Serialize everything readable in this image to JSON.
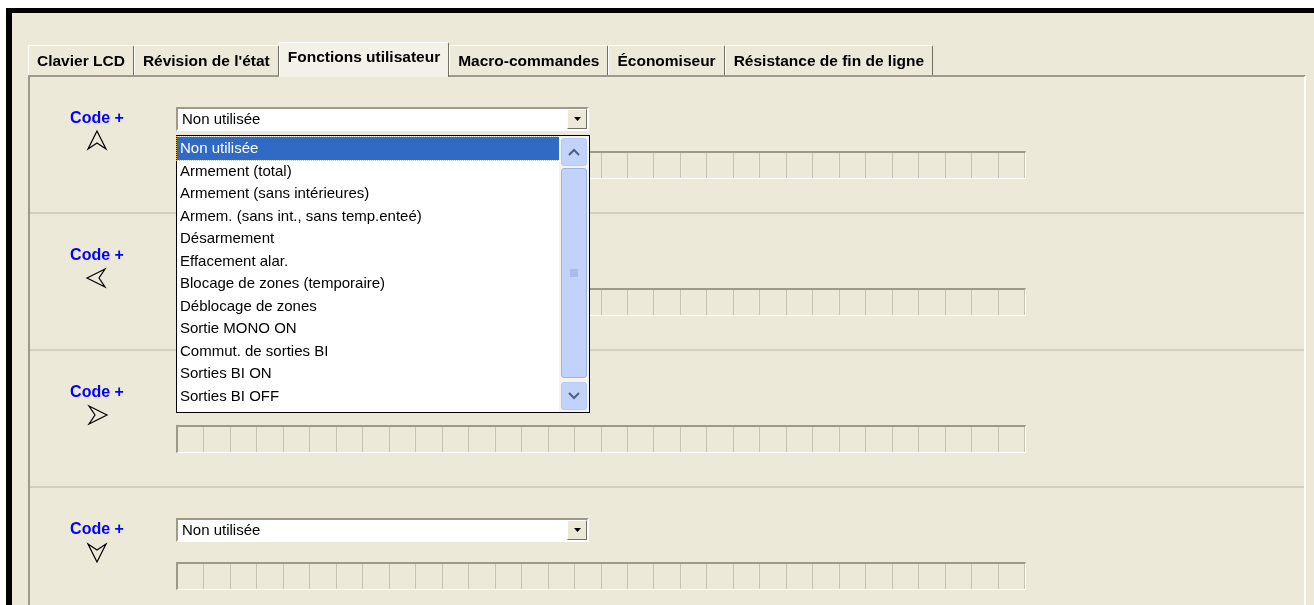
{
  "tabs": [
    {
      "label": "Clavier LCD",
      "selected": false
    },
    {
      "label": "Révision de l'état",
      "selected": false
    },
    {
      "label": "Fonctions utilisateur",
      "selected": true
    },
    {
      "label": "Macro-commandes",
      "selected": false
    },
    {
      "label": "Économiseur",
      "selected": false
    },
    {
      "label": "Résistance de fin de ligne",
      "selected": false
    }
  ],
  "sections": [
    {
      "label": "Code +",
      "kind": "up",
      "combo": {
        "value": "Non utilisée",
        "options": [
          {
            "label": "Non utilisée",
            "selected": true
          },
          {
            "label": "Armement (total)",
            "selected": false
          },
          {
            "label": "Armement (sans intérieures)",
            "selected": false
          },
          {
            "label": "Armem. (sans int., sans temp.enteé)",
            "selected": false
          },
          {
            "label": "Désarmement",
            "selected": false
          },
          {
            "label": "Effacement alar.",
            "selected": false
          },
          {
            "label": "Blocage de zones (temporaire)",
            "selected": false
          },
          {
            "label": "Déblocage de zones",
            "selected": false
          },
          {
            "label": "Sortie MONO ON",
            "selected": false
          },
          {
            "label": "Commut. de sorties BI",
            "selected": false
          },
          {
            "label": "Sorties BI ON",
            "selected": false
          },
          {
            "label": "Sorties BI OFF",
            "selected": false
          }
        ]
      }
    },
    {
      "label": "Code +",
      "kind": "left"
    },
    {
      "label": "Code +",
      "kind": "right"
    },
    {
      "label": "Code +",
      "kind": "down",
      "combo": {
        "value": "Non utilisée"
      }
    }
  ]
}
